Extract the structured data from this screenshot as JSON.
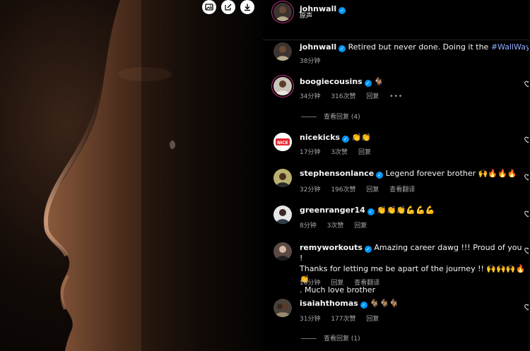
{
  "post": {
    "author": "johnwall",
    "audio": "原声",
    "caption_user": "johnwall",
    "caption_text": "Retired but never done. Doing it the",
    "caption_hashtag": "#WallWay",
    "caption_time": "38分钟"
  },
  "labels": {
    "reply": "回复",
    "see_translation": "查看翻译"
  },
  "comments": [
    {
      "user": "boogiecousins",
      "text": "🐐",
      "time": "34分钟",
      "likes": "316次赞",
      "has_more": true,
      "view_replies": "查看回复 (4)"
    },
    {
      "user": "nicekicks",
      "text": "👏👏",
      "time": "17分钟",
      "likes": "3次赞",
      "avatar_label": "NICE"
    },
    {
      "user": "stephensonlance",
      "text": "Legend forever brother 🙌🔥🔥🔥",
      "time": "32分钟",
      "likes": "196次赞",
      "translate": true
    },
    {
      "user": "greenranger14",
      "text": "👏👏👏💪💪💪",
      "time": "8分钟",
      "likes": "3次赞"
    },
    {
      "user": "remyworkouts",
      "text_line1": "Amazing career dawg !!! Proud of you !",
      "text_line2": "Thanks for letting me be apart of the journey !! 🙌🙌🙌🔥👏",
      "text_line3": ". Much love brother",
      "time": "16分钟",
      "translate": true
    },
    {
      "user": "isaiahthomas",
      "text": "🐐🐐🐐",
      "time": "31分钟",
      "likes": "177次赞",
      "view_replies": "查看回复 (1)"
    }
  ],
  "icons": [
    "image-icon",
    "edit-icon",
    "download-icon",
    "verified-icon",
    "heart-icon",
    "more-icon"
  ],
  "colors": {
    "verified": "#0095f6",
    "hashtag": "#8faffa",
    "muted": "#a8a8a8",
    "nice_red": "#e0282e"
  }
}
